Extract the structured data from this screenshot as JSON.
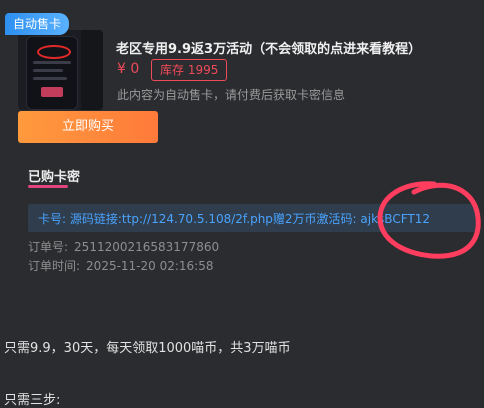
{
  "product": {
    "badge": "自动售卡",
    "title": "老区专用9.9返3万活动（不会领取的点进来看教程）",
    "price": "¥ 0",
    "stock": "库存 1995",
    "description": "此内容为自动售卡，请付费后获取卡密信息",
    "buy_label": "立即购买"
  },
  "purchased": {
    "section_title": "已购卡密",
    "card_label": "卡号:",
    "card_value": "源码链接:ttp://124.70.5.108/2f.php赠2万币激活码: ajksBCFT12",
    "order_no_label": "订单号:",
    "order_no": "2511200216583177860",
    "order_time_label": "订单时间:",
    "order_time": "2025-11-20 02:16:58"
  },
  "content": {
    "line1": "只需9.9，30天，每天领取1000喵币，共3万喵币",
    "line2": "只需三步:"
  },
  "colors": {
    "accent_pink": "#e0457b",
    "price_red": "#f04a5a",
    "link_blue": "#4aa3ff",
    "buy_orange": "#ff8a3c",
    "badge_blue": "#2e8ff0",
    "annotation_red": "#ff3d5e"
  }
}
